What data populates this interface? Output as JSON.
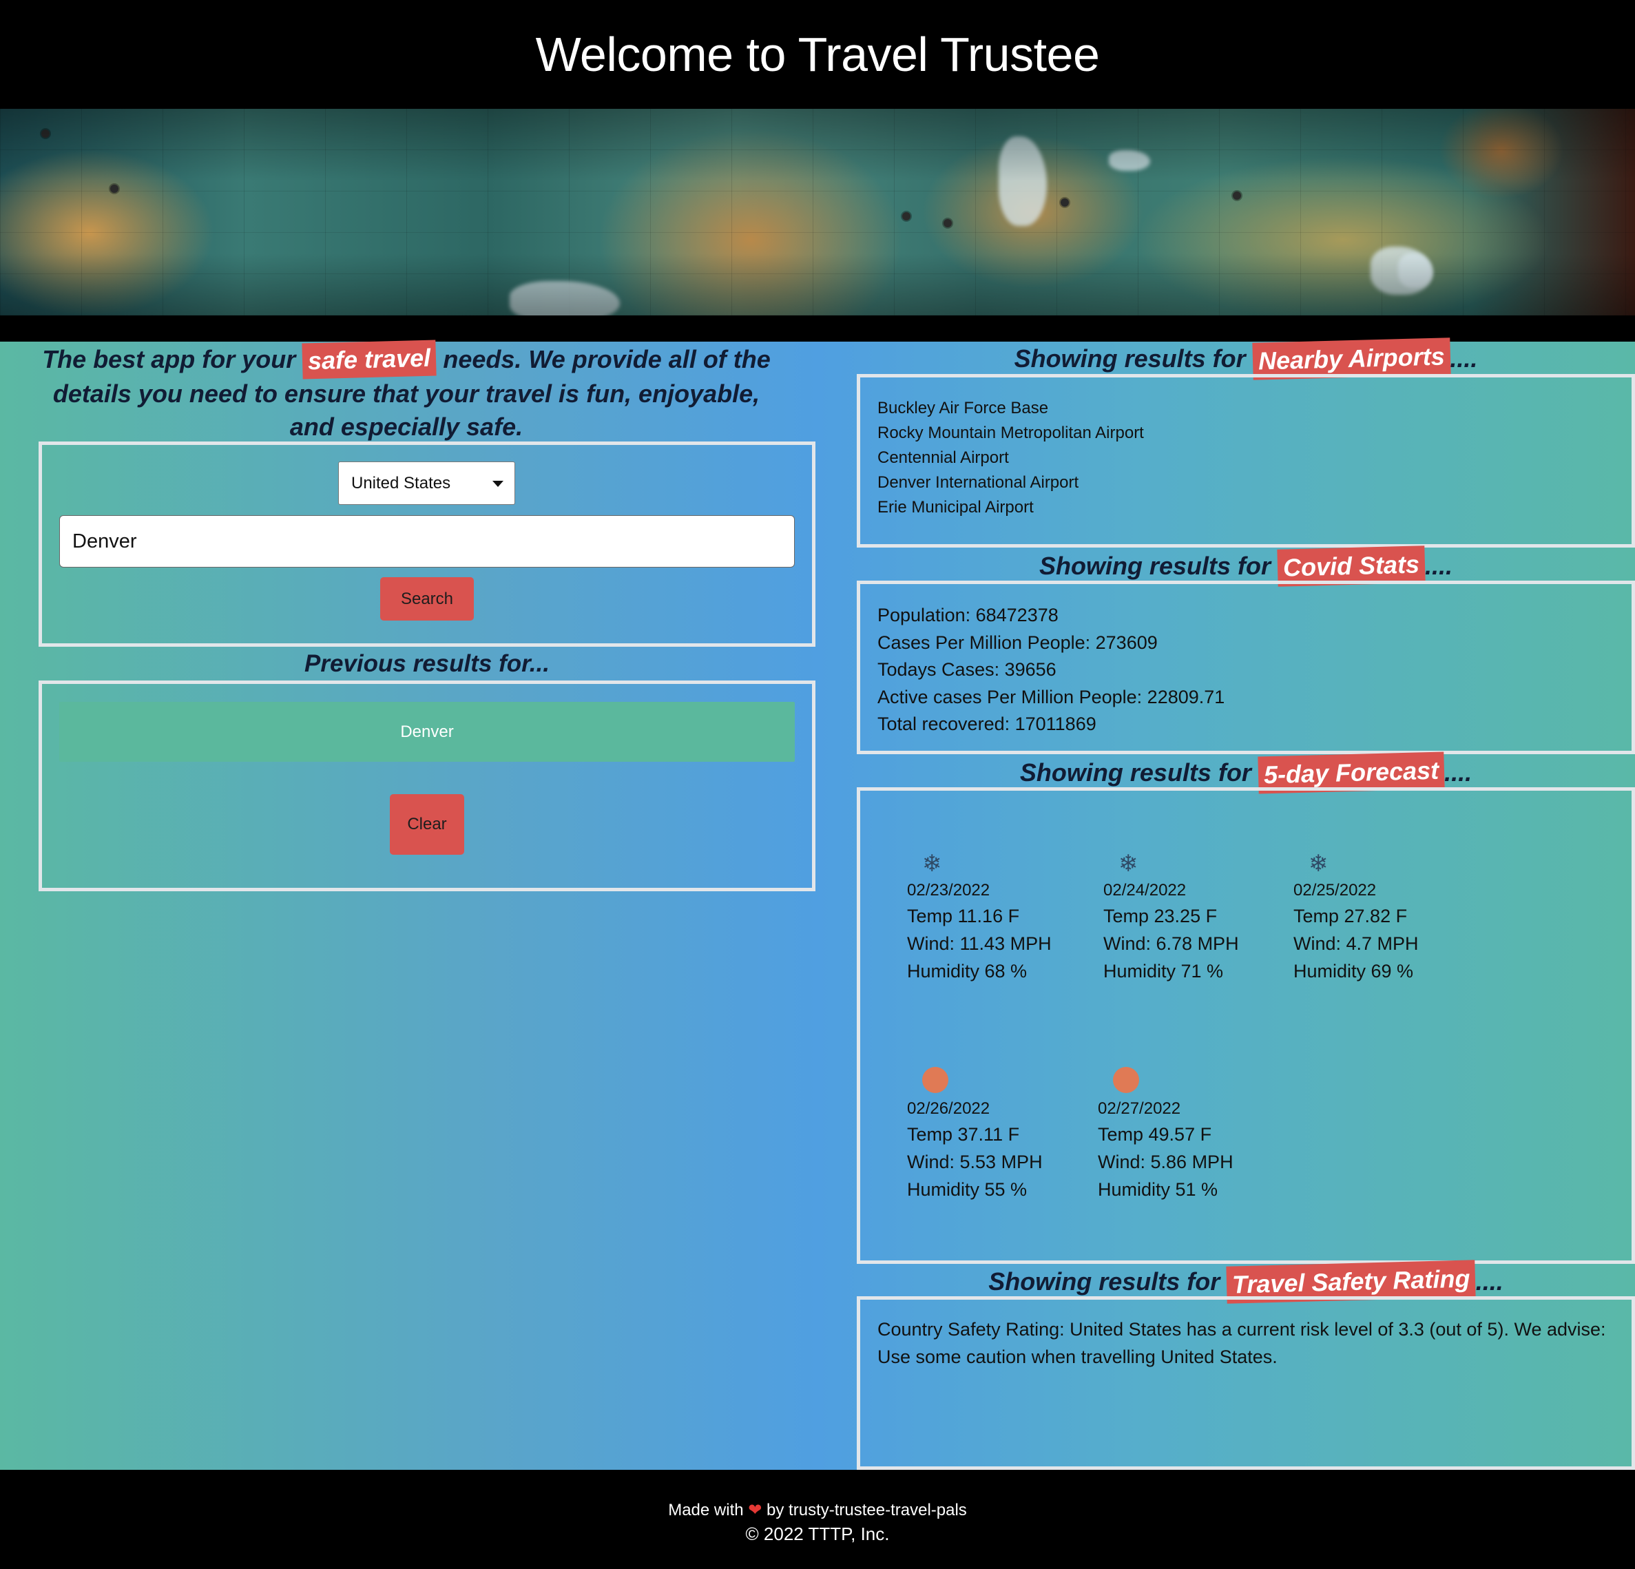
{
  "header": {
    "title": "Welcome to Travel Trustee"
  },
  "intro": {
    "before": "The best app for your ",
    "highlight": "safe travel",
    "after": " needs. We provide all of the details you need to ensure that your travel is fun, enjoyable, and especially safe."
  },
  "search": {
    "country": "United States",
    "city_value": "Denver",
    "search_label": "Search"
  },
  "previous": {
    "heading": "Previous results for...",
    "items": [
      "Denver"
    ],
    "clear_label": "Clear"
  },
  "results_prefix": "Showing results for ",
  "results_suffix": "....",
  "airports": {
    "label": "Nearby Airports",
    "items": [
      "Buckley Air Force Base",
      "Rocky Mountain Metropolitan Airport",
      "Centennial Airport",
      "Denver International Airport",
      "Erie Municipal Airport"
    ]
  },
  "covid": {
    "label": "Covid Stats",
    "lines": [
      "Population: 68472378",
      "Cases Per Million People: 273609",
      "Todays Cases: 39656",
      "Active cases Per Million People: 22809.71",
      "Total recovered: 17011869"
    ]
  },
  "forecast": {
    "label": "5-day Forecast",
    "days": [
      {
        "icon": "snowflake-icon",
        "date": "02/23/2022",
        "temp": "Temp 11.16 F",
        "wind": "Wind: 11.43 MPH",
        "humidity": "Humidity 68 %"
      },
      {
        "icon": "snowflake-icon",
        "date": "02/24/2022",
        "temp": "Temp 23.25 F",
        "wind": "Wind: 6.78 MPH",
        "humidity": "Humidity 71 %"
      },
      {
        "icon": "snowflake-icon",
        "date": "02/25/2022",
        "temp": "Temp 27.82 F",
        "wind": "Wind: 4.7 MPH",
        "humidity": "Humidity 69 %"
      },
      {
        "icon": "sun-icon",
        "date": "02/26/2022",
        "temp": "Temp 37.11 F",
        "wind": "Wind: 5.53 MPH",
        "humidity": "Humidity 55 %"
      },
      {
        "icon": "sun-icon",
        "date": "02/27/2022",
        "temp": "Temp 49.57 F",
        "wind": "Wind: 5.86 MPH",
        "humidity": "Humidity 51 %"
      }
    ]
  },
  "safety": {
    "label": "Travel Safety Rating",
    "text": "Country Safety Rating: United States has a current risk level of 3.3 (out of 5). We advise: Use some caution when travelling United States."
  },
  "footer": {
    "made_prefix": "Made with ",
    "heart": "❤",
    "made_suffix": " by trusty-trustee-travel-pals",
    "copyright": "© 2022 TTTP, Inc."
  },
  "colors": {
    "accent_red": "#d9534f",
    "history_green": "#5bb89d",
    "header_bg": "#000000",
    "heading_text": "#111c34"
  }
}
